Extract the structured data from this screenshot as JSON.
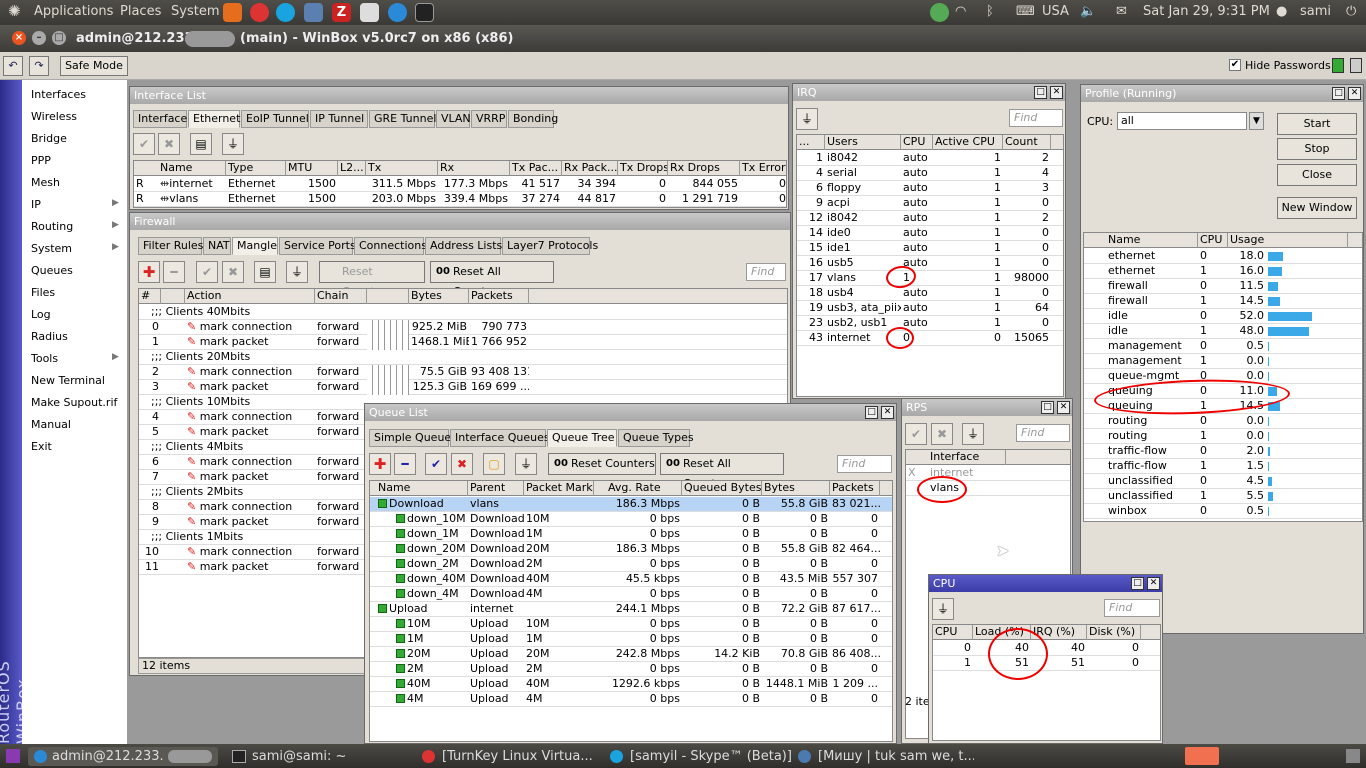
{
  "top_panel": {
    "menus": [
      "Applications",
      "Places",
      "System"
    ],
    "locale": "USA",
    "clock": "Sat Jan 29,  9:31 PM",
    "user": "sami"
  },
  "winbox": {
    "title": "admin@212.233.",
    "title_suffix": "(main) - WinBox v5.0rc7 on x86 (x86)",
    "safe_mode": "Safe Mode",
    "hide_passwords": "Hide Passwords",
    "brand": "RouterOS WinBox"
  },
  "menu": [
    "Interfaces",
    "Wireless",
    "Bridge",
    "PPP",
    "Mesh",
    "IP",
    "Routing",
    "System",
    "Queues",
    "Files",
    "Log",
    "Radius",
    "Tools",
    "New Terminal",
    "Make Supout.rif",
    "Manual",
    "Exit"
  ],
  "interface_list": {
    "title": "Interface List",
    "tabs": [
      "Interface",
      "Ethernet",
      "EoIP Tunnel",
      "IP Tunnel",
      "GRE Tunnel",
      "VLAN",
      "VRRP",
      "Bonding"
    ],
    "columns": [
      "Name",
      "Type",
      "MTU",
      "L2...",
      "Tx",
      "Rx",
      "Tx Pac...",
      "Rx Pack...",
      "Tx Drops",
      "Rx Drops",
      "Tx Errors"
    ],
    "rows": [
      [
        "R",
        "internet",
        "Ethernet",
        "1500",
        "",
        "311.5 Mbps",
        "177.3 Mbps",
        "41 517",
        "34 394",
        "0",
        "844 055",
        "0"
      ],
      [
        "R",
        "vlans",
        "Ethernet",
        "1500",
        "",
        "203.0 Mbps",
        "339.4 Mbps",
        "37 274",
        "44 817",
        "0",
        "1 291 719",
        "0"
      ]
    ]
  },
  "firewall": {
    "title": "Firewall",
    "tabs": [
      "Filter Rules",
      "NAT",
      "Mangle",
      "Service Ports",
      "Connections",
      "Address Lists",
      "Layer7 Protocols"
    ],
    "reset_counters": "Reset Counters",
    "reset_all": "Reset All Counters",
    "find": "Find",
    "columns": [
      "#",
      "Action",
      "Chain",
      "Bytes",
      "Packets"
    ],
    "status": "12 items",
    "rows": [
      {
        "comment": ";;; Clients 40Mbits"
      },
      {
        "n": "0",
        "action": "mark connection",
        "chain": "forward",
        "bytes": "925.2 MiB",
        "packets": "790 773"
      },
      {
        "n": "1",
        "action": "mark packet",
        "chain": "forward",
        "bytes": "1468.1 MiB",
        "packets": "1 766 952"
      },
      {
        "comment": ";;; Clients 20Mbits"
      },
      {
        "n": "2",
        "action": "mark connection",
        "chain": "forward",
        "bytes": "75.5 GiB",
        "packets": "93 408 131"
      },
      {
        "n": "3",
        "action": "mark packet",
        "chain": "forward",
        "bytes": "125.3 GiB",
        "packets": "169 699 ..."
      },
      {
        "comment": ";;; Clients 10Mbits"
      },
      {
        "n": "4",
        "action": "mark connection",
        "chain": "forward",
        "bytes": "",
        "packets": ""
      },
      {
        "n": "5",
        "action": "mark packet",
        "chain": "forward",
        "bytes": "",
        "packets": ""
      },
      {
        "comment": ";;; Clients 4Mbits"
      },
      {
        "n": "6",
        "action": "mark connection",
        "chain": "forward",
        "bytes": "",
        "packets": ""
      },
      {
        "n": "7",
        "action": "mark packet",
        "chain": "forward",
        "bytes": "",
        "packets": ""
      },
      {
        "comment": ";;; Clients 2Mbits"
      },
      {
        "n": "8",
        "action": "mark connection",
        "chain": "forward",
        "bytes": "",
        "packets": ""
      },
      {
        "n": "9",
        "action": "mark packet",
        "chain": "forward",
        "bytes": "",
        "packets": ""
      },
      {
        "comment": ";;; Clients 1Mbits"
      },
      {
        "n": "10",
        "action": "mark connection",
        "chain": "forward",
        "bytes": "",
        "packets": ""
      },
      {
        "n": "11",
        "action": "mark packet",
        "chain": "forward",
        "bytes": "",
        "packets": ""
      }
    ]
  },
  "queue_list": {
    "title": "Queue List",
    "tabs": [
      "Simple Queues",
      "Interface Queues",
      "Queue Tree",
      "Queue Types"
    ],
    "reset_counters": "Reset Counters",
    "reset_all": "Reset All Counters",
    "find": "Find",
    "columns": [
      "Name",
      "Parent",
      "Packet Marks",
      "Avg. Rate",
      "Queued Bytes",
      "Bytes",
      "Packets"
    ],
    "rows": [
      {
        "name": "Download",
        "parent": "vlans",
        "marks": "",
        "rate": "186.3 Mbps",
        "queued": "0 B",
        "bytes": "55.8 GiB",
        "packets": "83 021...",
        "lvl": 0,
        "sel": true
      },
      {
        "name": "down_10M",
        "parent": "Download",
        "marks": "10M",
        "rate": "0 bps",
        "queued": "0 B",
        "bytes": "0 B",
        "packets": "0",
        "lvl": 1
      },
      {
        "name": "down_1M",
        "parent": "Download",
        "marks": "1M",
        "rate": "0 bps",
        "queued": "0 B",
        "bytes": "0 B",
        "packets": "0",
        "lvl": 1
      },
      {
        "name": "down_20M",
        "parent": "Download",
        "marks": "20M",
        "rate": "186.3 Mbps",
        "queued": "0 B",
        "bytes": "55.8 GiB",
        "packets": "82 464...",
        "lvl": 1
      },
      {
        "name": "down_2M",
        "parent": "Download",
        "marks": "2M",
        "rate": "0 bps",
        "queued": "0 B",
        "bytes": "0 B",
        "packets": "0",
        "lvl": 1
      },
      {
        "name": "down_40M",
        "parent": "Download",
        "marks": "40M",
        "rate": "45.5 kbps",
        "queued": "0 B",
        "bytes": "43.5 MiB",
        "packets": "557 307",
        "lvl": 1
      },
      {
        "name": "down_4M",
        "parent": "Download",
        "marks": "4M",
        "rate": "0 bps",
        "queued": "0 B",
        "bytes": "0 B",
        "packets": "0",
        "lvl": 1
      },
      {
        "name": "Upload",
        "parent": "internet",
        "marks": "",
        "rate": "244.1 Mbps",
        "queued": "0 B",
        "bytes": "72.2 GiB",
        "packets": "87 617...",
        "lvl": 0
      },
      {
        "name": "10M",
        "parent": "Upload",
        "marks": "10M",
        "rate": "0 bps",
        "queued": "0 B",
        "bytes": "0 B",
        "packets": "0",
        "lvl": 1
      },
      {
        "name": "1M",
        "parent": "Upload",
        "marks": "1M",
        "rate": "0 bps",
        "queued": "0 B",
        "bytes": "0 B",
        "packets": "0",
        "lvl": 1
      },
      {
        "name": "20M",
        "parent": "Upload",
        "marks": "20M",
        "rate": "242.8 Mbps",
        "queued": "14.2 KiB",
        "bytes": "70.8 GiB",
        "packets": "86 408...",
        "lvl": 1
      },
      {
        "name": "2M",
        "parent": "Upload",
        "marks": "2M",
        "rate": "0 bps",
        "queued": "0 B",
        "bytes": "0 B",
        "packets": "0",
        "lvl": 1
      },
      {
        "name": "40M",
        "parent": "Upload",
        "marks": "40M",
        "rate": "1292.6 kbps",
        "queued": "0 B",
        "bytes": "1448.1 MiB",
        "packets": "1 209 ...",
        "lvl": 1
      },
      {
        "name": "4M",
        "parent": "Upload",
        "marks": "4M",
        "rate": "0 bps",
        "queued": "0 B",
        "bytes": "0 B",
        "packets": "0",
        "lvl": 1
      }
    ]
  },
  "irq": {
    "title": "IRQ",
    "find": "Find",
    "columns": [
      "...",
      "Users",
      "CPU",
      "Active CPU",
      "Count"
    ],
    "rows": [
      [
        "1",
        "i8042",
        "auto",
        "1",
        "2"
      ],
      [
        "4",
        "serial",
        "auto",
        "1",
        "4"
      ],
      [
        "6",
        "floppy",
        "auto",
        "1",
        "3"
      ],
      [
        "9",
        "acpi",
        "auto",
        "1",
        "0"
      ],
      [
        "12",
        "i8042",
        "auto",
        "1",
        "2"
      ],
      [
        "14",
        "ide0",
        "auto",
        "1",
        "0"
      ],
      [
        "15",
        "ide1",
        "auto",
        "1",
        "0"
      ],
      [
        "16",
        "usb5",
        "auto",
        "1",
        "0"
      ],
      [
        "17",
        "vlans",
        "1",
        "1",
        "98000"
      ],
      [
        "18",
        "usb4",
        "auto",
        "1",
        "0"
      ],
      [
        "19",
        "usb3, ata_piix",
        "auto",
        "1",
        "64"
      ],
      [
        "23",
        "usb2, usb1",
        "auto",
        "1",
        "0"
      ],
      [
        "43",
        "internet",
        "0",
        "0",
        "15065"
      ]
    ]
  },
  "profile": {
    "title": "Profile (Running)",
    "cpu_label": "CPU:",
    "cpu_value": "all",
    "buttons": [
      "Start",
      "Stop",
      "Close",
      "New Window"
    ],
    "columns": [
      "Name",
      "CPU",
      "Usage"
    ],
    "rows": [
      [
        "ethernet",
        "0",
        "18.0"
      ],
      [
        "ethernet",
        "1",
        "16.0"
      ],
      [
        "firewall",
        "0",
        "11.5"
      ],
      [
        "firewall",
        "1",
        "14.5"
      ],
      [
        "idle",
        "0",
        "52.0"
      ],
      [
        "idle",
        "1",
        "48.0"
      ],
      [
        "management",
        "0",
        "0.5"
      ],
      [
        "management",
        "1",
        "0.0"
      ],
      [
        "queue-mgmt",
        "0",
        "0.0"
      ],
      [
        "queuing",
        "0",
        "11.0"
      ],
      [
        "queuing",
        "1",
        "14.5"
      ],
      [
        "routing",
        "0",
        "0.0"
      ],
      [
        "routing",
        "1",
        "0.0"
      ],
      [
        "traffic-flow",
        "0",
        "2.0"
      ],
      [
        "traffic-flow",
        "1",
        "1.5"
      ],
      [
        "unclassified",
        "0",
        "4.5"
      ],
      [
        "unclassified",
        "1",
        "5.5"
      ],
      [
        "winbox",
        "0",
        "0.5"
      ]
    ]
  },
  "rps": {
    "title": "RPS",
    "find": "Find",
    "column": "Interface",
    "rows": [
      {
        "flag": "X",
        "name": "internet",
        "disabled": true
      },
      {
        "flag": "",
        "name": "vlans",
        "disabled": false
      }
    ],
    "status": "2 ite"
  },
  "cpu": {
    "title": "CPU",
    "find": "Find",
    "columns": [
      "CPU",
      "Load (%)",
      "IRQ (%)",
      "Disk (%)"
    ],
    "rows": [
      [
        "0",
        "40",
        "40",
        "0"
      ],
      [
        "1",
        "51",
        "51",
        "0"
      ]
    ]
  },
  "taskbar": {
    "tasks": [
      "admin@212.233.",
      "sami@sami: ~",
      "[TurnKey Linux Virtua...",
      "[samyil - Skype™ (Beta)]",
      "[Мишу | tuk sam we, t..."
    ]
  }
}
